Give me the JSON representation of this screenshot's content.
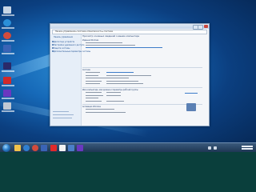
{
  "window": {
    "address": "Панель управления ▸ Система и безопасность ▸ Система",
    "sections": [
      "Издание Windows",
      "Система",
      "Имя компьютера, имя домена и параметры рабочей группы",
      "Активация Windows"
    ]
  },
  "sidebar": {
    "items": [
      "Панель управления",
      "Диспетчер устройств",
      "Настройка удалённого доступа",
      "Защита системы",
      "Дополнительные параметры системы"
    ]
  },
  "colors": {
    "desktop": "#1669b8",
    "taskbar": "#1b3350",
    "accent_link": "#3d7cc9",
    "bezel": "#0a3f3c"
  },
  "icons": {
    "desktop": [
      "recycle-bin-icon",
      "edge-icon",
      "chrome-icon",
      "app-icon",
      "app-icon",
      "app-icon",
      "app-icon",
      "app-icon"
    ],
    "windows_logo": "windows-logo-icon"
  }
}
